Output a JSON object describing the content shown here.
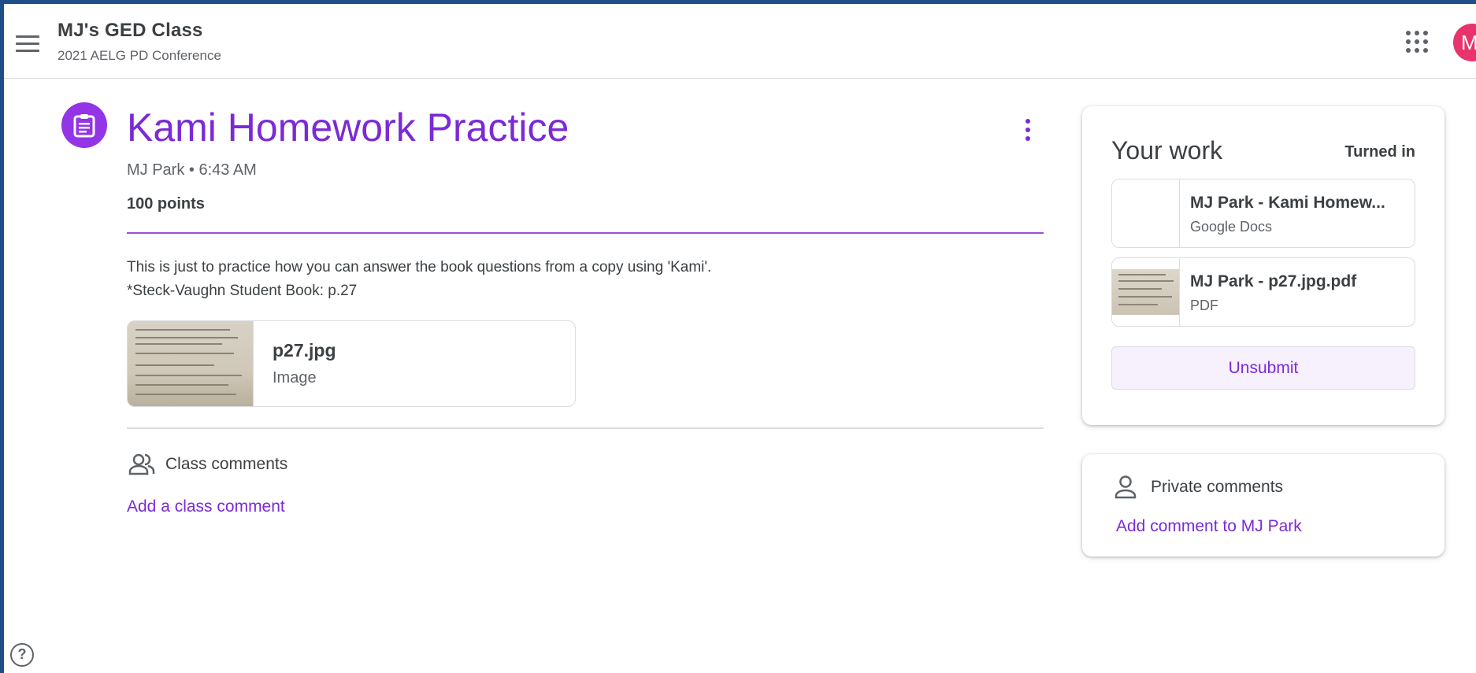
{
  "header": {
    "class_name": "MJ's GED Class",
    "class_section": "2021 AELG PD Conference",
    "avatar_initial": "M"
  },
  "assignment": {
    "title": "Kami Homework Practice",
    "author_time": "MJ Park • 6:43 AM",
    "points": "100 points",
    "description_line1": "This is just to practice how you can answer the book questions from a copy using 'Kami'.",
    "description_line2": "*Steck-Vaughn Student Book: p.27",
    "attachment": {
      "name": "p27.jpg",
      "type": "Image"
    }
  },
  "class_comments": {
    "label": "Class comments",
    "add_link": "Add a class comment"
  },
  "your_work": {
    "title": "Your work",
    "status": "Turned in",
    "files": [
      {
        "name": "MJ Park - Kami Homew...",
        "type": "Google Docs"
      },
      {
        "name": "MJ Park - p27.jpg.pdf",
        "type": "PDF"
      }
    ],
    "unsubmit_label": "Unsubmit"
  },
  "private_comments": {
    "label": "Private comments",
    "add_link": "Add comment to MJ Park"
  },
  "help": {
    "glyph": "?"
  },
  "colors": {
    "accent": "#7b2ad6",
    "icon_circle": "#9334e6",
    "avatar": "#e8336d"
  }
}
